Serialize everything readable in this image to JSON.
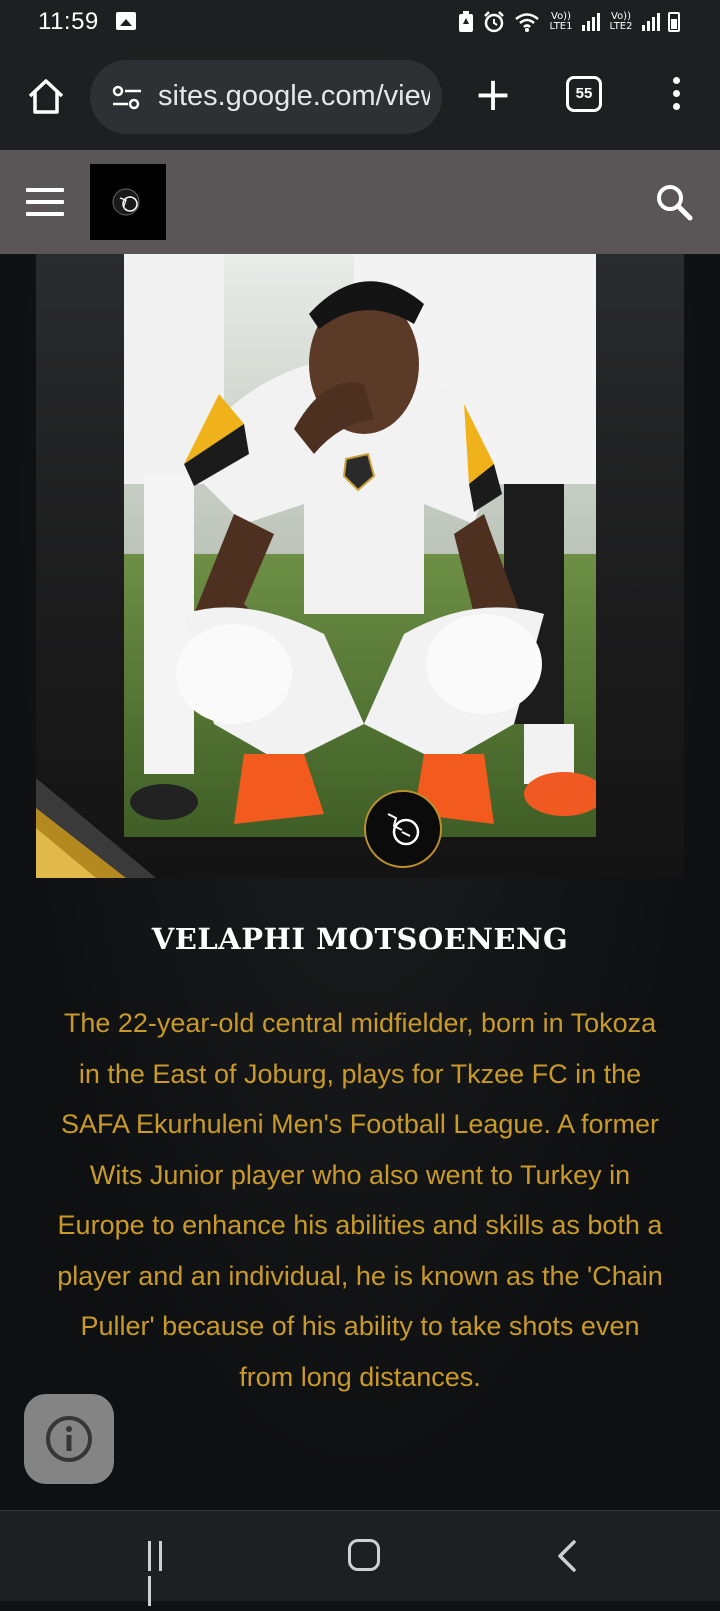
{
  "status_bar": {
    "time": "11:59",
    "sim1_label": "Vo)) LTE1",
    "sim2_label": "Vo)) LTE2",
    "icons": [
      "image-icon",
      "battery-saver-icon",
      "alarm-icon",
      "wifi-icon",
      "signal-icon",
      "battery-icon"
    ]
  },
  "browser": {
    "url": "sites.google.com/view",
    "tab_count": "55",
    "icons": [
      "home-icon",
      "site-settings-icon",
      "plus-icon",
      "tabs-icon",
      "more-vert-icon"
    ]
  },
  "site_header": {
    "icons": [
      "menu-icon",
      "logo-icon",
      "search-icon"
    ]
  },
  "article": {
    "player_name": "VELAPHI MOTSOENENG",
    "bio": "The 22-year-old central midfielder, born in Tokoza in the East of Joburg, plays for Tkzee FC in the SAFA Ekurhuleni Men's Football League. A former Wits Junior player who also went to Turkey in Europe to enhance his abilities and skills as both a player and an individual, he is known as the 'Chain Puller' because of his ability to take shots even from long distances."
  },
  "colors": {
    "accent_gold": "#c99a28",
    "header_bg": "#5a5658",
    "page_bg": "#111213"
  },
  "system_nav": {
    "icons": [
      "recents-icon",
      "home-nav-icon",
      "back-icon"
    ]
  }
}
